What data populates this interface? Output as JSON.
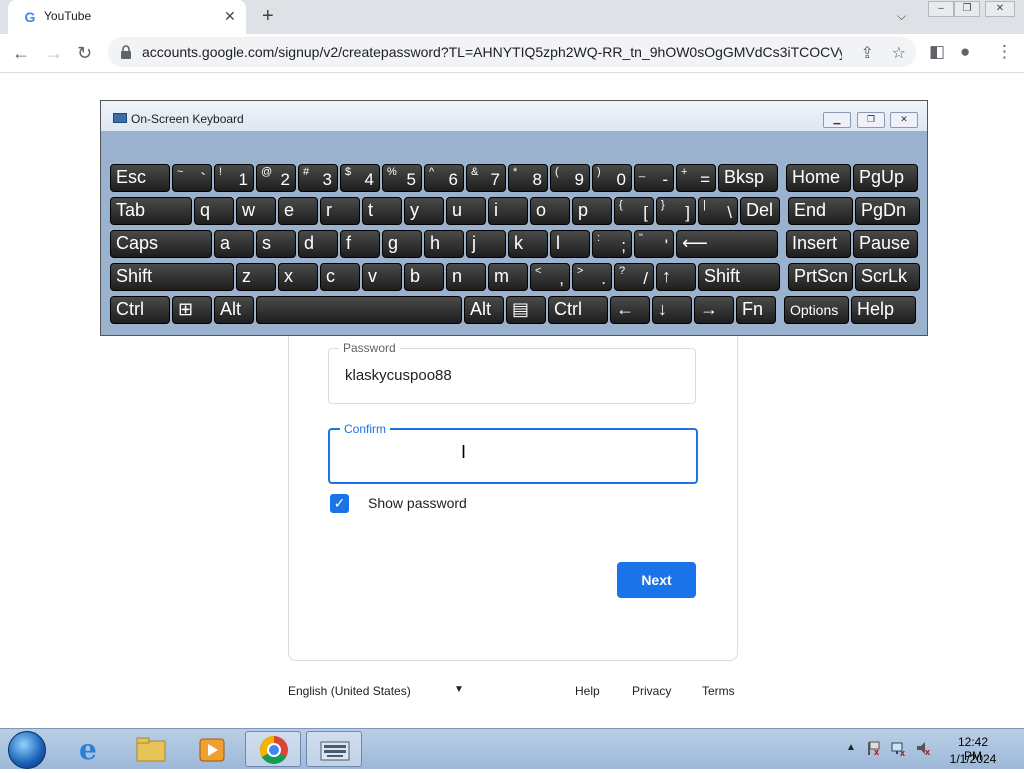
{
  "browser": {
    "tab_title": "YouTube",
    "url": "accounts.google.com/signup/v2/createpassword?TL=AHNYTIQ5zph2WQ-RR_tn_9hOW0sOgGMVdCs3iTCOCVyh..."
  },
  "osk": {
    "title": "On-Screen Keyboard",
    "rows": [
      [
        {
          "label": "Esc"
        },
        {
          "shift": "~",
          "main": "`"
        },
        {
          "shift": "!",
          "main": "1"
        },
        {
          "shift": "@",
          "main": "2"
        },
        {
          "shift": "#",
          "main": "3"
        },
        {
          "shift": "$",
          "main": "4"
        },
        {
          "shift": "%",
          "main": "5"
        },
        {
          "shift": "^",
          "main": "6"
        },
        {
          "shift": "&",
          "main": "7"
        },
        {
          "shift": "*",
          "main": "8"
        },
        {
          "shift": "(",
          "main": "9"
        },
        {
          "shift": ")",
          "main": "0"
        },
        {
          "shift": "_",
          "main": "-"
        },
        {
          "shift": "+",
          "main": "="
        },
        {
          "label": "Bksp"
        },
        {
          "label": "Home"
        },
        {
          "label": "PgUp"
        }
      ],
      [
        {
          "label": "Tab"
        },
        {
          "label": "q"
        },
        {
          "label": "w"
        },
        {
          "label": "e"
        },
        {
          "label": "r"
        },
        {
          "label": "t"
        },
        {
          "label": "y"
        },
        {
          "label": "u"
        },
        {
          "label": "i"
        },
        {
          "label": "o"
        },
        {
          "label": "p"
        },
        {
          "shift": "{",
          "main": "["
        },
        {
          "shift": "}",
          "main": "]"
        },
        {
          "shift": "|",
          "main": "\\"
        },
        {
          "label": "Del"
        },
        {
          "label": "End"
        },
        {
          "label": "PgDn"
        }
      ],
      [
        {
          "label": "Caps"
        },
        {
          "label": "a"
        },
        {
          "label": "s"
        },
        {
          "label": "d"
        },
        {
          "label": "f"
        },
        {
          "label": "g"
        },
        {
          "label": "h"
        },
        {
          "label": "j"
        },
        {
          "label": "k"
        },
        {
          "label": "l"
        },
        {
          "shift": ":",
          "main": ";"
        },
        {
          "shift": "\"",
          "main": "'"
        },
        {
          "label": "⟵"
        },
        {
          "label": "Insert"
        },
        {
          "label": "Pause"
        }
      ],
      [
        {
          "label": "Shift"
        },
        {
          "label": "z"
        },
        {
          "label": "x"
        },
        {
          "label": "c"
        },
        {
          "label": "v"
        },
        {
          "label": "b"
        },
        {
          "label": "n"
        },
        {
          "label": "m"
        },
        {
          "shift": "<",
          "main": ","
        },
        {
          "shift": ">",
          "main": "."
        },
        {
          "shift": "?",
          "main": "/"
        },
        {
          "label": "↑"
        },
        {
          "label": "Shift"
        },
        {
          "label": "PrtScn"
        },
        {
          "label": "ScrLk"
        }
      ],
      [
        {
          "label": "Ctrl"
        },
        {
          "label": "⊞"
        },
        {
          "label": "Alt"
        },
        {
          "label": ""
        },
        {
          "label": "Alt"
        },
        {
          "label": "▤"
        },
        {
          "label": "Ctrl"
        },
        {
          "label": "←"
        },
        {
          "label": "↓"
        },
        {
          "label": "→"
        },
        {
          "label": "Fn"
        },
        {
          "label": "Options"
        },
        {
          "label": "Help"
        }
      ]
    ]
  },
  "form": {
    "password_label": "Password",
    "password_value": "klaskycuspoo88",
    "confirm_label": "Confirm",
    "confirm_value": "",
    "show_password_label": "Show password",
    "show_password_checked": true,
    "next_label": "Next"
  },
  "footer": {
    "language": "English (United States)",
    "help": "Help",
    "privacy": "Privacy",
    "terms": "Terms"
  },
  "taskbar": {
    "time": "12:42 PM",
    "date": "1/1/2024"
  }
}
